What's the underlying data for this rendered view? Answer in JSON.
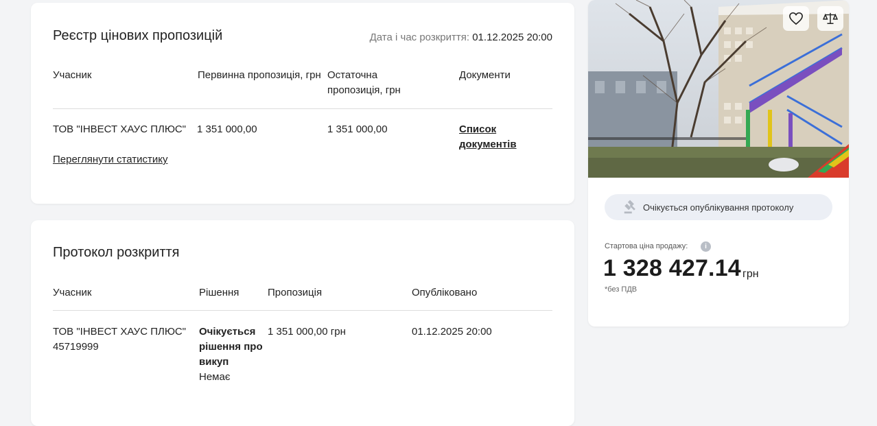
{
  "registry": {
    "title": "Реєстр цінових пропозицій",
    "opening_label": "Дата і час розкриття:",
    "opening_value": "01.12.2025 20:00",
    "columns": [
      "Учасник",
      "Первинна пропозиція, грн",
      "Остаточна пропозиція, грн",
      "Документи"
    ],
    "rows": [
      {
        "participant": "ТОВ \"ІНВЕСТ ХАУС ПЛЮС\"",
        "stats_link": "Переглянути статистику",
        "initial": "1 351 000,00",
        "final": "1 351 000,00",
        "documents_link": "Список документів"
      }
    ]
  },
  "protocol": {
    "title": "Протокол розкриття",
    "columns": [
      "Учасник",
      "Рішення",
      "Пропозиція",
      "Опубліковано"
    ],
    "rows": [
      {
        "participant": "ТОВ \"ІНВЕСТ ХАУС ПЛЮС\"",
        "participant_id": "45719999",
        "decision": "Очікується рішення про викуп",
        "decision_note": "Немає",
        "offer": "1 351 000,00 грн",
        "published": "01.12.2025 20:00"
      }
    ]
  },
  "sidebar": {
    "favorite_icon": "heart-icon",
    "compare_icon": "scales-icon",
    "status_icon": "gavel-icon",
    "status": "Очікується опублікування протоколу",
    "price_label": "Стартова ціна продажу:",
    "price_value": "1 328 427.14",
    "price_currency": "грн",
    "price_note": "*без ПДВ"
  }
}
